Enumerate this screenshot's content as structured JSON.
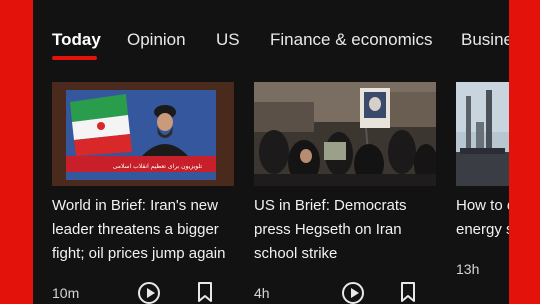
{
  "tabs": [
    {
      "label": "Today",
      "active": true
    },
    {
      "label": "Opinion",
      "active": false
    },
    {
      "label": "US",
      "active": false
    },
    {
      "label": "Finance & economics",
      "active": false
    },
    {
      "label": "Busine",
      "active": false
    }
  ],
  "cards": [
    {
      "headline_lines": [
        "World in Brief: Iran's new",
        "leader threatens a bigger",
        "fight; oil prices jump again"
      ],
      "time": "10m",
      "image_caption": "تلویزیون برای تعظیم انقلاب اسلامی"
    },
    {
      "headline_lines": [
        "US in Brief: Democrats",
        "press Hegseth on Iran",
        "school strike"
      ],
      "time": "4h"
    },
    {
      "headline_lines": [
        "How to e",
        "energy s"
      ],
      "time": "13h"
    }
  ],
  "colors": {
    "brand_red": "#e3120b",
    "panel_bg": "#121212",
    "text": "#f2f2f2"
  },
  "icons": [
    "play-icon",
    "bookmark-icon"
  ]
}
